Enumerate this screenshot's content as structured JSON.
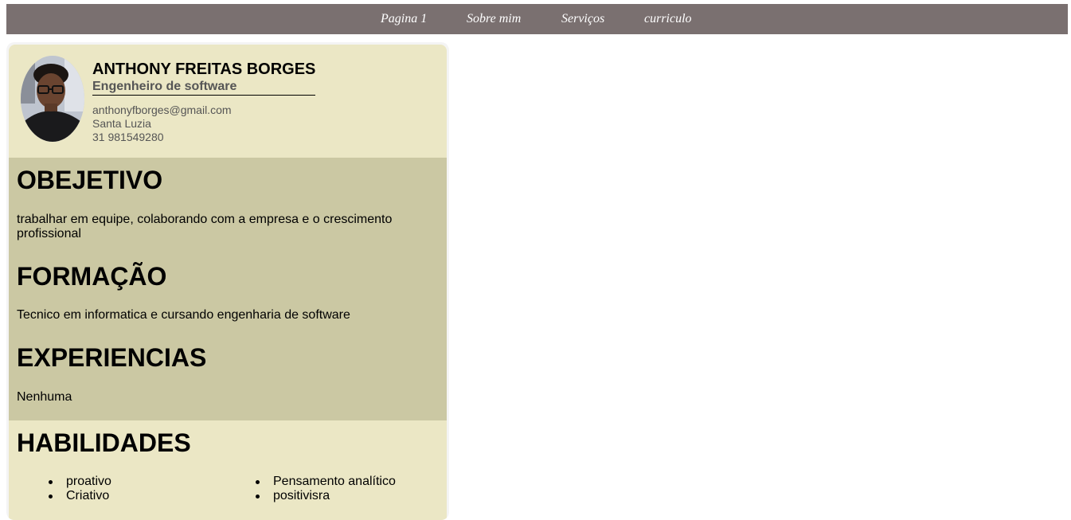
{
  "nav": {
    "items": [
      "Pagina 1",
      "Sobre mim",
      "Serviços",
      "curriculo"
    ]
  },
  "profile": {
    "name": "ANTHONY FREITAS BORGES",
    "role": "Engenheiro de software",
    "email": "anthonyfborges@gmail.com",
    "city": "Santa Luzia",
    "phone": "31 981549280"
  },
  "sections": {
    "objective": {
      "title": "OBEJETIVO",
      "text": "trabalhar em equipe, colaborando com a empresa e o crescimento profissional"
    },
    "education": {
      "title": "FORMAÇÃO",
      "text": "Tecnico em informatica e cursando engenharia de software"
    },
    "experience": {
      "title": "EXPERIENCIAS",
      "text": "Nenhuma"
    },
    "skills": {
      "title": "HABILIDADES",
      "left": [
        "proativo",
        "Criativo"
      ],
      "right": [
        "Pensamento analítico",
        "positivisra"
      ]
    }
  },
  "colors": {
    "nav_bg": "#7a7070",
    "header_bg": "#ebe7c5",
    "middle_bg": "#cbc8a3"
  }
}
